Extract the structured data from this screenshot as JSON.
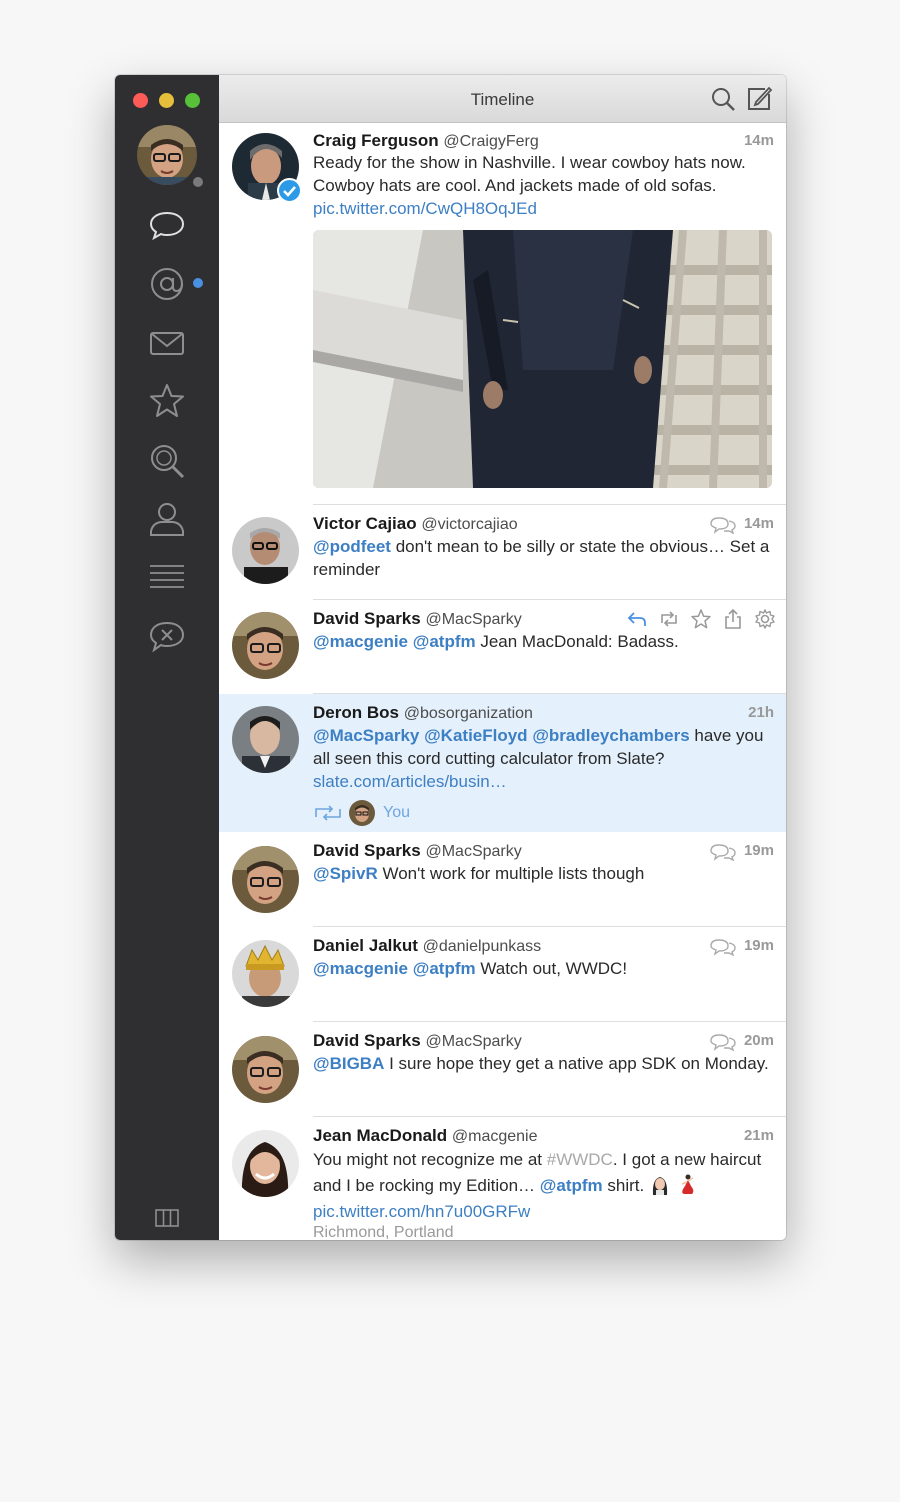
{
  "window": {
    "title": "Timeline"
  },
  "colors": {
    "accent": "#3d7fc4",
    "sidebar": "#2f2f31",
    "highlight": "#e4f0fb",
    "unread_dot": "#4a90e2"
  },
  "sidebar": {
    "items": [
      {
        "icon": "speech-bubble-icon",
        "label": "Timeline"
      },
      {
        "icon": "at-sign-icon",
        "label": "Mentions"
      },
      {
        "icon": "envelope-icon",
        "label": "Messages"
      },
      {
        "icon": "star-icon",
        "label": "Favorites"
      },
      {
        "icon": "magnifier-icon",
        "label": "Search"
      },
      {
        "icon": "person-icon",
        "label": "Profile"
      },
      {
        "icon": "list-icon",
        "label": "Lists"
      },
      {
        "icon": "muted-bubble-icon",
        "label": "Mute"
      }
    ],
    "footer_icon": "columns-icon"
  },
  "toolbar": {
    "search_icon": "search-icon",
    "compose_icon": "compose-icon"
  },
  "tweets": [
    {
      "name": "Craig Ferguson",
      "handle": "@CraigyFerg",
      "time": "14m",
      "text": "Ready for the show in Nashville. I wear cowboy hats now. Cowboy hats are cool. And jackets made of old sofas.",
      "link": "pic.twitter.com/CwQH8OqJEd",
      "verified": true
    },
    {
      "name": "Victor Cajiao",
      "handle": "@victorcajiao",
      "time": "14m",
      "mention": "@podfeet",
      "text": " don't mean to be silly or state the obvious… Set a reminder"
    },
    {
      "name": "David Sparks",
      "handle": "@MacSparky",
      "mentions": [
        "@macgenie",
        "@atpfm"
      ],
      "text": " Jean MacDonald: Badass."
    },
    {
      "name": "Deron Bos",
      "handle": "@bosorganization",
      "time": "21h",
      "mentions": [
        "@MacSparky",
        "@KatieFloyd",
        "@bradleychambers"
      ],
      "text": " have you all seen this cord cutting calculator from Slate?",
      "link": "slate.com/articles/busin…",
      "retweeted_by": "You"
    },
    {
      "name": "David Sparks",
      "handle": "@MacSparky",
      "time": "19m",
      "mention": "@SpivR",
      "text": " Won't work for multiple lists though"
    },
    {
      "name": "Daniel Jalkut",
      "handle": "@danielpunkass",
      "time": "19m",
      "mentions": [
        "@macgenie",
        "@atpfm"
      ],
      "text": " Watch out, WWDC!"
    },
    {
      "name": "David Sparks",
      "handle": "@MacSparky",
      "time": "20m",
      "mention": "@BIGBA",
      "text": " I sure hope they get a native app SDK on Monday."
    },
    {
      "name": "Jean MacDonald",
      "handle": "@macgenie",
      "time": "21m",
      "text_pre": "You might not recognize me at ",
      "hashtag": "#WWDC",
      "text_mid": ". I got a new haircut and I be rocking my Edition… ",
      "mention": "@atpfm",
      "text_post": " shirt.",
      "link": "pic.twitter.com/hn7u00GRFw",
      "location": "Richmond, Portland"
    }
  ]
}
